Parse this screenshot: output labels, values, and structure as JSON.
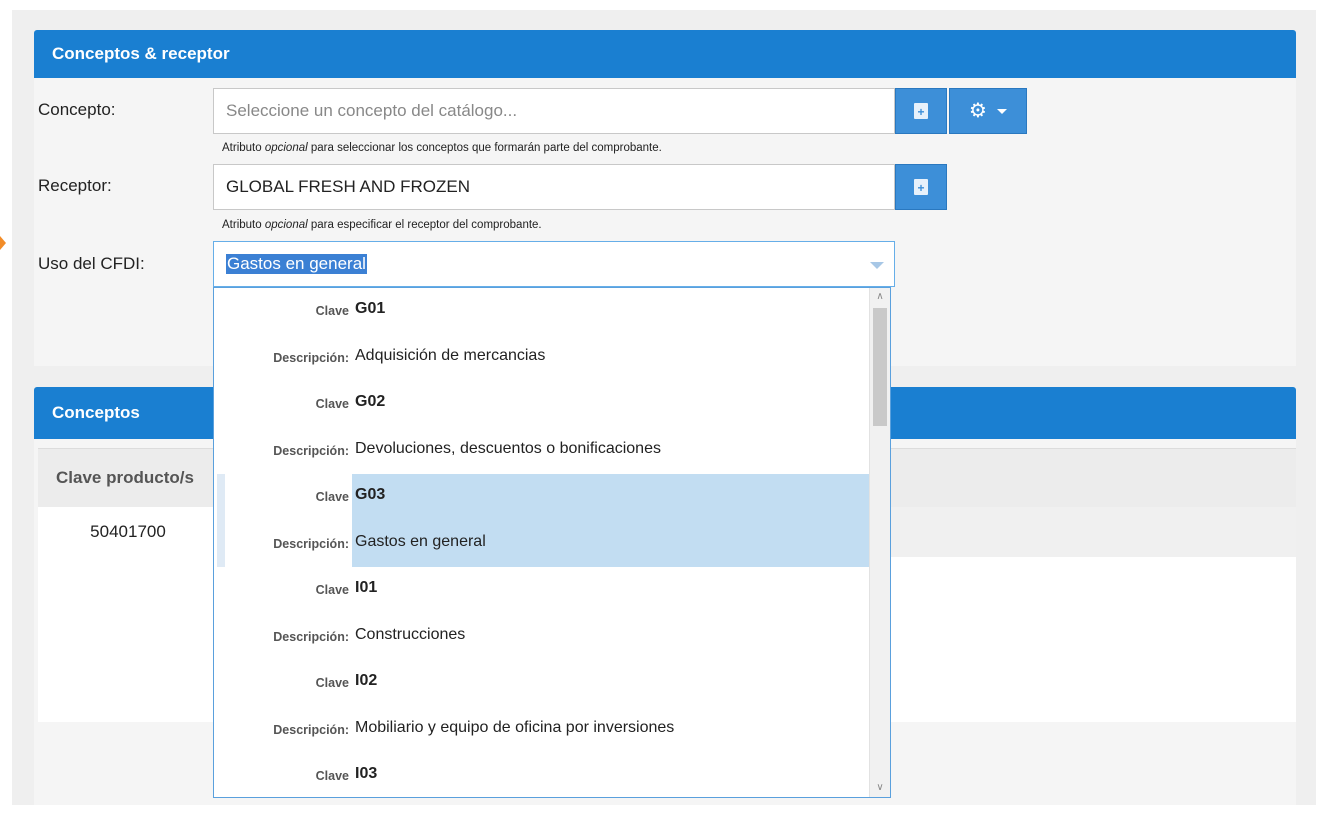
{
  "panels": {
    "top_title": "Conceptos & receptor",
    "bottom_title": "Conceptos"
  },
  "form": {
    "concepto_label": "Concepto:",
    "concepto_placeholder": "Seleccione un concepto del catálogo...",
    "concepto_help_pre": "Atributo ",
    "concepto_help_em": "opcional",
    "concepto_help_post": " para seleccionar los conceptos que formarán parte del comprobante.",
    "receptor_label": "Receptor:",
    "receptor_value": "GLOBAL FRESH AND FROZEN",
    "receptor_help_pre": "Atributo ",
    "receptor_help_em": "opcional",
    "receptor_help_post": " para especificar el receptor del comprobante.",
    "uso_label": "Uso del CFDI:",
    "uso_value": "Gastos en general"
  },
  "table": {
    "header_first": "Clave producto/s",
    "rows": [
      {
        "clave": "50401700"
      }
    ]
  },
  "dropdown": {
    "items": [
      {
        "key": "Clave",
        "value": "G01",
        "code": true
      },
      {
        "key": "Descripción:",
        "value": "Adquisición de mercancias"
      },
      {
        "key": "Clave",
        "value": "G02",
        "code": true
      },
      {
        "key": "Descripción:",
        "value": "Devoluciones, descuentos o bonificaciones"
      },
      {
        "key": "Clave",
        "value": "G03",
        "code": true,
        "selected": true
      },
      {
        "key": "Descripción:",
        "value": "Gastos en general",
        "selected": true
      },
      {
        "key": "Clave",
        "value": "I01",
        "code": true
      },
      {
        "key": "Descripción:",
        "value": "Construcciones"
      },
      {
        "key": "Clave",
        "value": "I02",
        "code": true
      },
      {
        "key": "Descripción:",
        "value": "Mobiliario y equipo de oficina por inversiones"
      },
      {
        "key": "Clave",
        "value": "I03",
        "code": true
      }
    ]
  },
  "icons": {
    "add_document": "add-document-icon",
    "gear": "gear-icon",
    "caret": "chevron-down-icon"
  },
  "colors": {
    "header_blue": "#1a7fd1",
    "button_blue": "#3d8fd8",
    "selection": "#c2ddf2"
  }
}
